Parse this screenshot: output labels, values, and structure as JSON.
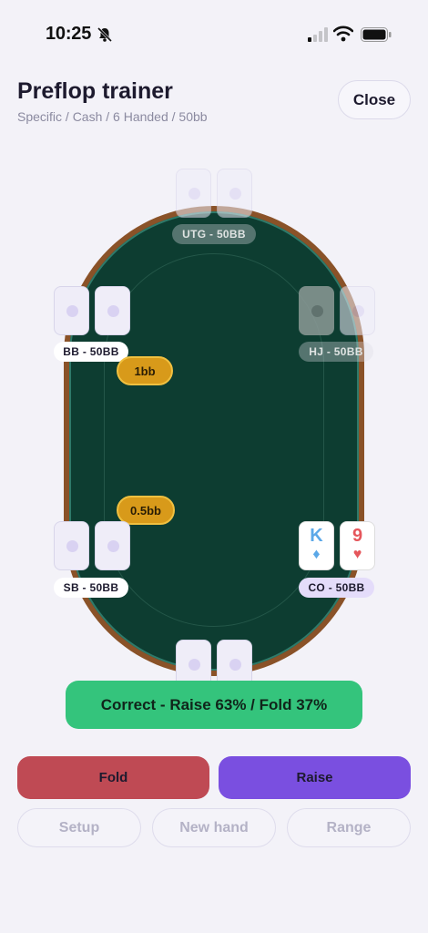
{
  "status_bar": {
    "time": "10:25",
    "icons": [
      "bell-slash-icon",
      "signal-icon",
      "wifi-icon",
      "battery-icon"
    ]
  },
  "header": {
    "title": "Preflop trainer",
    "subtitle": "Specific / Cash / 6 Handed / 50bb",
    "close_label": "Close"
  },
  "seats": {
    "utg": "UTG - 50BB",
    "hj": "HJ - 50BB",
    "bb": "BB - 50BB",
    "sb": "SB - 50BB",
    "co": "CO - 50BB"
  },
  "hero_cards": [
    {
      "rank": "K",
      "suit": "♦",
      "color": "#5ba8e8"
    },
    {
      "rank": "9",
      "suit": "♥",
      "color": "#e5565b"
    }
  ],
  "bets": {
    "bb": "1bb",
    "sb": "0.5bb"
  },
  "feedback": "Correct - Raise 63% / Fold 37%",
  "actions": {
    "fold": "Fold",
    "raise": "Raise"
  },
  "secondary": {
    "setup": "Setup",
    "new_hand": "New hand",
    "range": "Range"
  },
  "colors": {
    "felt": "#0d3d31",
    "rail": "#8a5228",
    "fold": "#bf4a54",
    "raise": "#7a4fe0",
    "correct": "#34c47c",
    "chip": "#d89a1a"
  }
}
